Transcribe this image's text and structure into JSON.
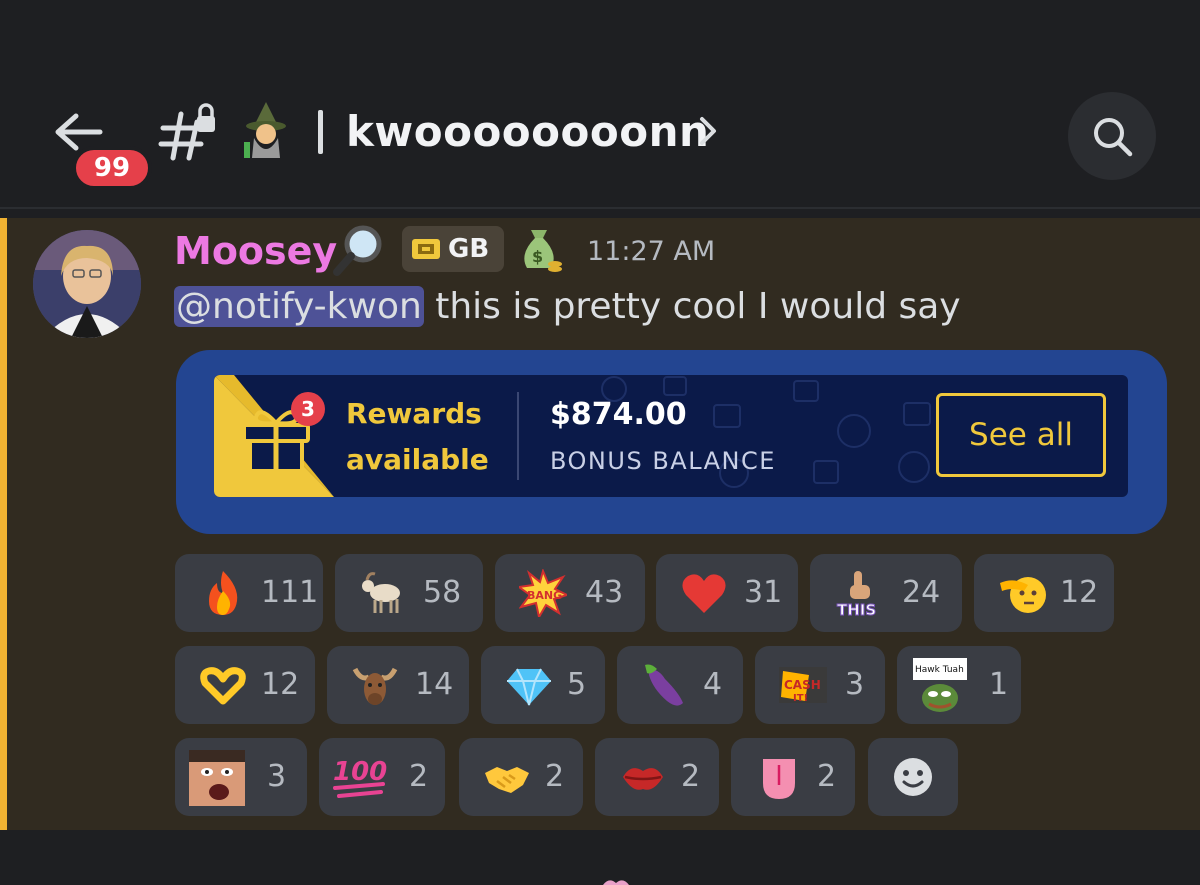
{
  "header": {
    "unread_badge": "99",
    "channel_title": "kwoooooooonn",
    "icons": {
      "back": "back-arrow-icon",
      "channel": "locked-channel-hash-icon",
      "channel_emoji": "mage-emoji",
      "chevron": "chevron-right-icon",
      "search": "search-icon"
    }
  },
  "message": {
    "author": "Moosey",
    "author_color": "#ec79e2",
    "tag": "GB",
    "timestamp": "11:27 AM",
    "mention": "@notify-kwon",
    "text": " this is pretty cool I would say",
    "highlight_color": "#f0b232",
    "badges": [
      "magnifying-glass-emoji",
      "money-bag-emoji"
    ]
  },
  "rewards_card": {
    "gift_count": "3",
    "rewards_title_line1": "Rewards",
    "rewards_title_line2": "available",
    "balance": "$874.00",
    "balance_label": "BONUS BALANCE",
    "button_label": "See all",
    "accent": "#f0c83c",
    "frame_color": "#234591"
  },
  "reactions": [
    {
      "emoji": "fire-emoji",
      "count": "111"
    },
    {
      "emoji": "goat-emoji",
      "count": "58"
    },
    {
      "emoji": "bang-sticker",
      "count": "43"
    },
    {
      "emoji": "red-heart-emoji",
      "count": "31"
    },
    {
      "emoji": "this-pointing-up-emoji",
      "count": "24"
    },
    {
      "emoji": "saluting-face-emoji",
      "count": "12"
    },
    {
      "emoji": "heart-hands-emoji",
      "count": "12"
    },
    {
      "emoji": "moose-emoji",
      "count": "14"
    },
    {
      "emoji": "gem-emoji",
      "count": "5"
    },
    {
      "emoji": "eggplant-emoji",
      "count": "4"
    },
    {
      "emoji": "cash-it-sticker",
      "count": "3"
    },
    {
      "emoji": "hawk-tuah-pepe-emoji",
      "count": "1",
      "label": "Hawk   Tuah"
    },
    {
      "emoji": "funny-face-emoji",
      "count": "3"
    },
    {
      "emoji": "hundred-emoji",
      "count": "2"
    },
    {
      "emoji": "handshake-emoji",
      "count": "2"
    },
    {
      "emoji": "kiss-mark-emoji",
      "count": "2"
    },
    {
      "emoji": "tongue-emoji",
      "count": "2"
    }
  ],
  "add_reaction_icon": "smiley-face-icon"
}
